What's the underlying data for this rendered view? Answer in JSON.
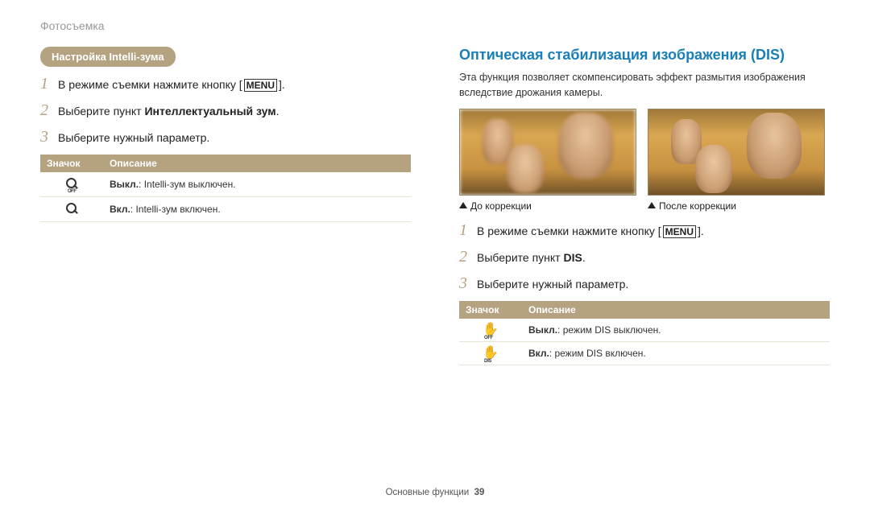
{
  "topic": "Фотосъемка",
  "footer_section": "Основные функции",
  "footer_page": "39",
  "left": {
    "pill": "Настройка Intelli-зума",
    "steps": [
      {
        "text": "В режиме съемки нажмите кнопку [",
        "suffix": "].",
        "has_menu": true
      },
      {
        "text": "Выберите пункт ",
        "bold": "Интеллектуальный зум",
        "suffix": "."
      },
      {
        "text": "Выберите нужный параметр."
      }
    ],
    "th_icon": "Значок",
    "th_desc": "Описание",
    "rows": [
      {
        "bold": "Выкл.",
        "rest": ": Intelli-зум выключен.",
        "icon_sub": "OFF"
      },
      {
        "bold": "Вкл.",
        "rest": ": Intelli-зум включен.",
        "icon_sub": ""
      }
    ]
  },
  "right": {
    "heading": "Оптическая стабилизация изображения (DIS)",
    "desc": "Эта функция позволяет скомпенсировать эффект размытия изображения вследствие дрожания камеры.",
    "cap_before": "До коррекции",
    "cap_after": "После коррекции",
    "steps": [
      {
        "text": "В режиме съемки нажмите кнопку [",
        "suffix": "].",
        "has_menu": true
      },
      {
        "text": "Выберите пункт ",
        "bold": "DIS",
        "suffix": "."
      },
      {
        "text": "Выберите нужный параметр."
      }
    ],
    "th_icon": "Значок",
    "th_desc": "Описание",
    "rows": [
      {
        "bold": "Выкл.",
        "rest": ": режим DIS выключен.",
        "icon_sub": "OFF"
      },
      {
        "bold": "Вкл.",
        "rest": ": режим DIS включен.",
        "icon_sub": "DIS"
      }
    ]
  },
  "menu_label": "MENU"
}
